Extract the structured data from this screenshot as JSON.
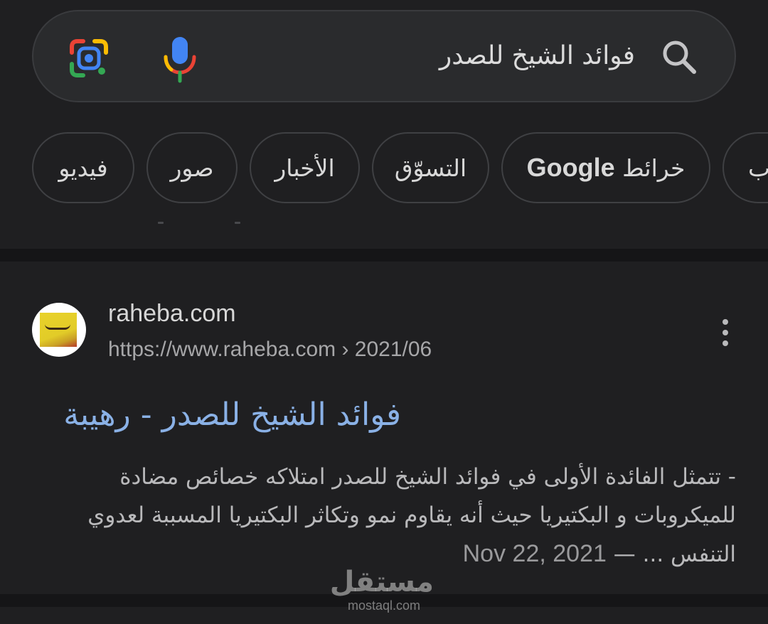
{
  "search": {
    "query": "فوائد الشيخ للصدر"
  },
  "chips": [
    {
      "label": "فيديو"
    },
    {
      "label": "صور"
    },
    {
      "label": "الأخبار"
    },
    {
      "label": "التسوّق"
    },
    {
      "label_prefix": "خرائط",
      "label_brand": "Google"
    },
    {
      "label": "ب"
    }
  ],
  "result": {
    "site_name": "raheba.com",
    "url": "https://www.raheba.com › 2021/06",
    "title": "فوائد الشيخ للصدر - رهيبة",
    "snippet_date": "Nov 22, 2021",
    "snippet_separator": " — ",
    "snippet_text": "- تتمثل الفائدة الأولى في فوائد الشيخ للصدر امتلاكه خصائص مضادة للميكروبات و البكتيريا حيث أنه يقاوم نمو وتكاثر البكتيريا المسببة لعدوي التنفس ..."
  },
  "watermark": {
    "arabic": "مستقل",
    "latin": "mostaql.com"
  },
  "colors": {
    "background": "#1f1f21",
    "link": "#8ab1e6",
    "google_blue": "#4285f4",
    "google_red": "#ea4335",
    "google_yellow": "#fbbc04",
    "google_green": "#34a853"
  }
}
